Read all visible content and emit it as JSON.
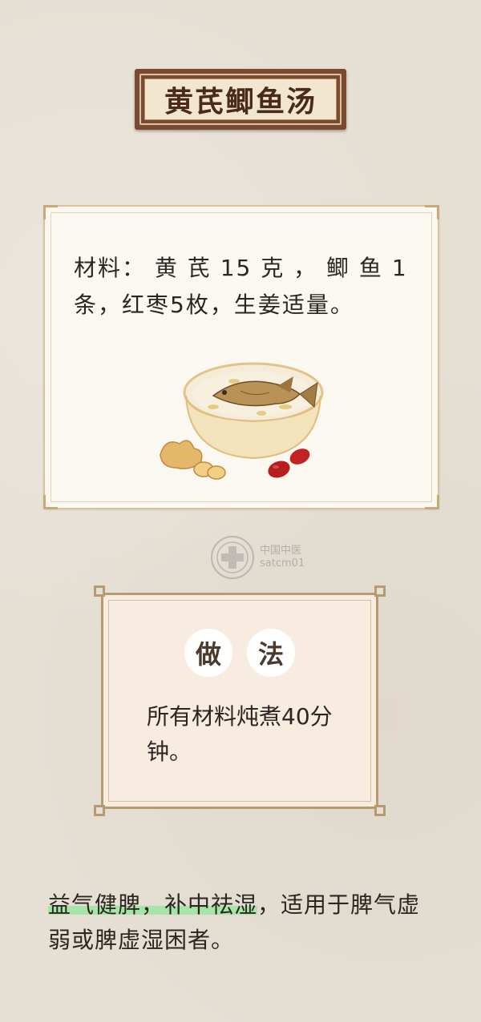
{
  "title": "黄芪鲫鱼汤",
  "materials": {
    "text": "材料： 黄 芪 15 克 ， 鲫 鱼 1 条，红枣5枚，生姜适量。"
  },
  "watermark": {
    "line1": "中国中医",
    "line2": "satcm01"
  },
  "method": {
    "heading_char1": "做",
    "heading_char2": "法",
    "text": "所有材料炖煮40分钟。"
  },
  "effect": {
    "highlight": "益气健脾，补中祛湿",
    "rest": "，适用于脾气虚弱或脾虚湿困者。"
  },
  "colors": {
    "background": "#e5dfd4",
    "plaque": "#7a4a33",
    "highlight": "#a6e4a8"
  }
}
